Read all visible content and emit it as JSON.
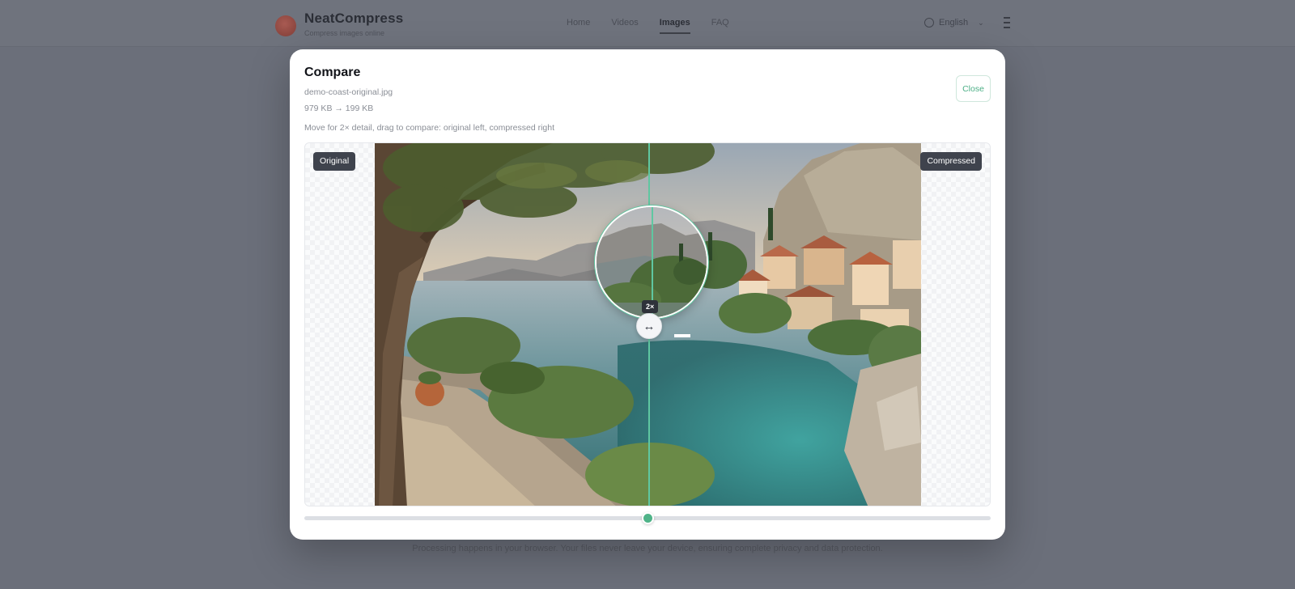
{
  "app": {
    "brand_name": "NeatCompress",
    "brand_tagline": "Compress images online",
    "nav": [
      "Home",
      "Videos",
      "Images",
      "FAQ"
    ],
    "nav_active": "Images",
    "language": "English"
  },
  "background": {
    "footer_text": "Processing happens in your browser. Your files never leave your device, ensuring complete privacy and data protection."
  },
  "modal": {
    "title": "Compare",
    "file_name": "demo-coast-original.jpg",
    "file_sizes": "979 KB → 199 KB",
    "instructions": "Move for 2× detail, drag to compare: original left, compressed right",
    "close_label": "Close",
    "original_label": "Original",
    "compressed_label": "Compressed",
    "zoom_label": "2×",
    "slider_percent": 50
  },
  "colors": {
    "accent": "#4fb388",
    "divider": "#5fc7a1",
    "badge_bg": "#3f434d"
  },
  "icons": {
    "handle": "arrows-left-right-icon",
    "language": "globe-icon",
    "menu": "more-vertical-icon"
  }
}
